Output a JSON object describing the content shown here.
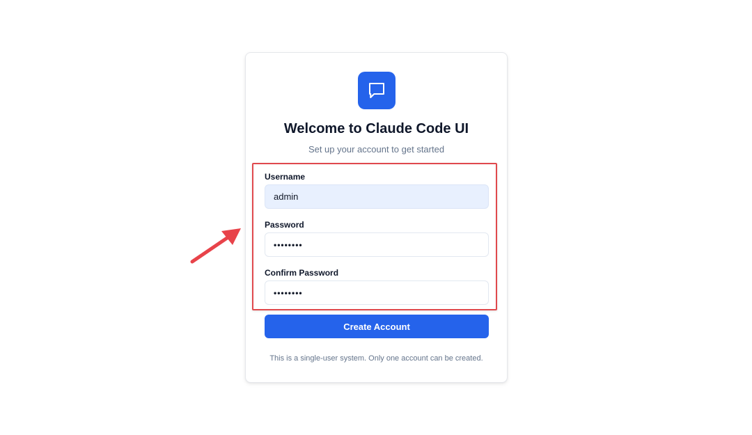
{
  "app": {
    "title": "Welcome to Claude Code UI",
    "subtitle": "Set up your account to get started",
    "logo_icon": "chat-bubble-icon",
    "accent_color": "#2563eb"
  },
  "form": {
    "username": {
      "label": "Username",
      "value": "admin"
    },
    "password": {
      "label": "Password",
      "value": "••••••••"
    },
    "confirm_password": {
      "label": "Confirm Password",
      "value": "••••••••"
    },
    "submit_label": "Create Account"
  },
  "footnote": "This is a single-user system. Only one account can be created.",
  "annotation": {
    "highlight_color": "#e0494d",
    "arrow_icon": "arrow-pointer-icon"
  }
}
